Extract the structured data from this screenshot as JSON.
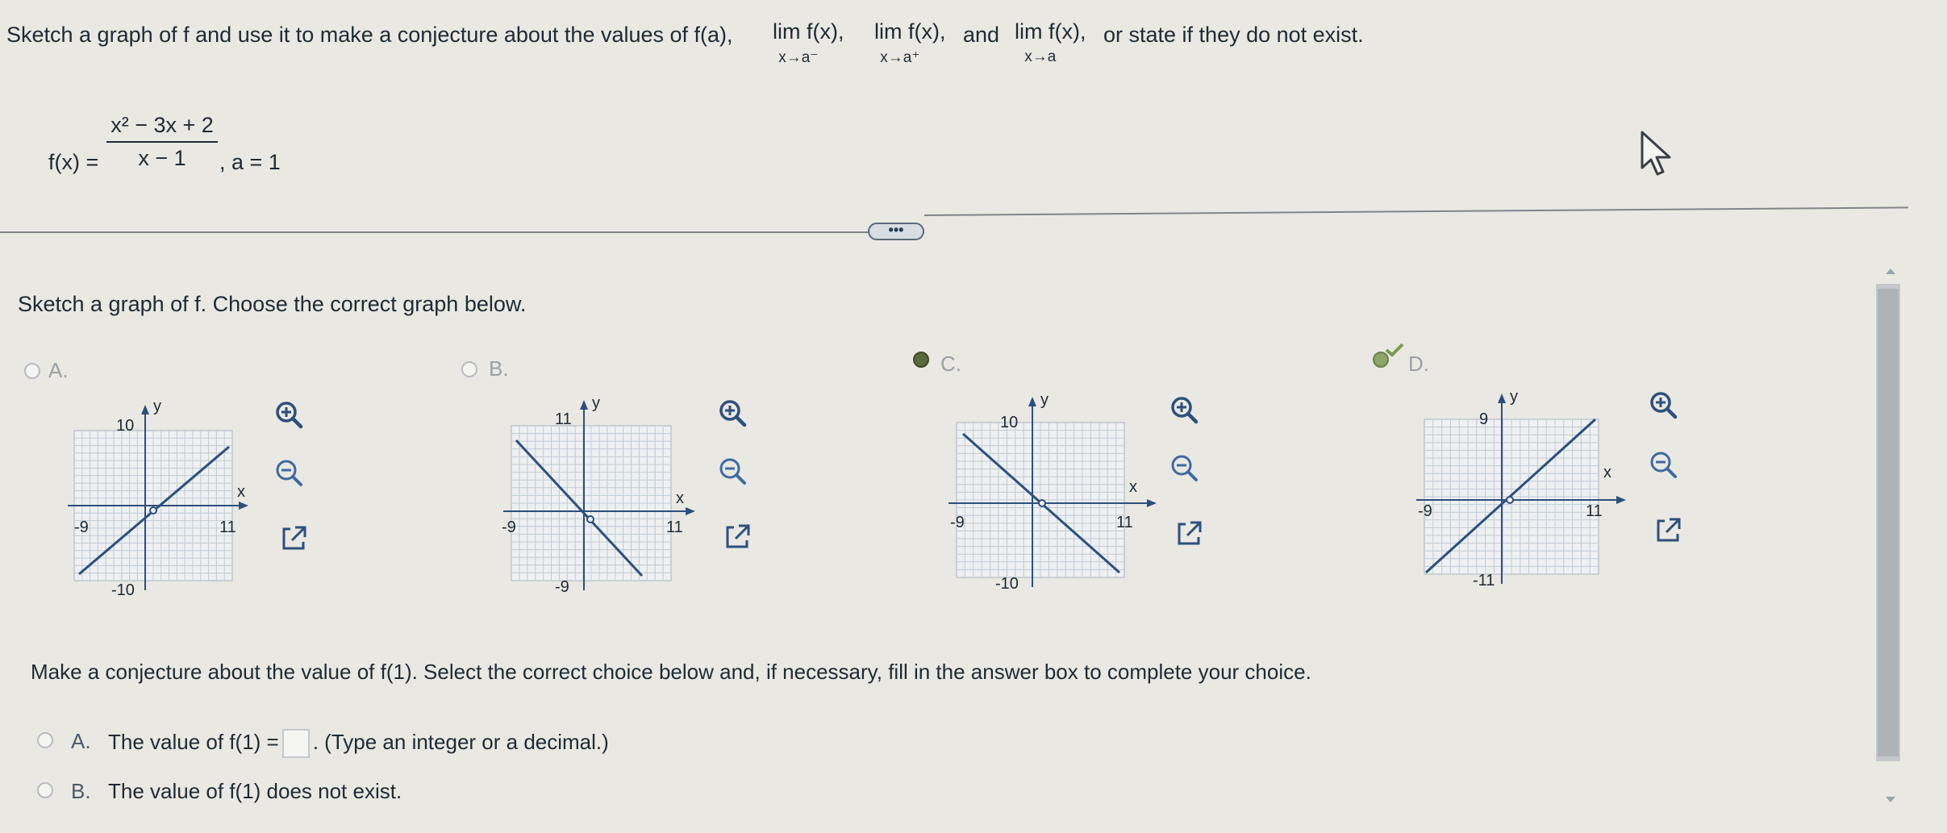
{
  "question": {
    "intro": "Sketch a graph of f and use it to make a conjecture about the values of f(a),",
    "lim1": "lim f(x),",
    "lim1_sub": "x→a⁻",
    "lim2": "lim f(x),",
    "lim2_sub": "x→a⁺",
    "and": "and",
    "lim3": "lim f(x),",
    "lim3_sub": "x→a",
    "outro": "or state if they do not exist.",
    "function_label": "f(x) =",
    "numerator": "x² − 3x + 2",
    "denominator": "x − 1",
    "a_value": ", a = 1"
  },
  "more_button": "•••",
  "part1": {
    "prompt": "Sketch a graph of f. Choose the correct graph below.",
    "options": [
      {
        "letter": "A.",
        "state": "unselected",
        "y_top": "10",
        "y_bottom": "-10",
        "x_left": "-9",
        "x_right": "11",
        "x_label": "x",
        "y_label": "y"
      },
      {
        "letter": "B.",
        "state": "unselected",
        "y_top": "11",
        "y_bottom": "-9",
        "x_left": "-9",
        "x_right": "11",
        "x_label": "x",
        "y_label": "y"
      },
      {
        "letter": "C.",
        "state": "selected",
        "y_top": "10",
        "y_bottom": "-10",
        "x_left": "-9",
        "x_right": "11",
        "x_label": "x",
        "y_label": "y"
      },
      {
        "letter": "D.",
        "state": "correct",
        "y_top": "9",
        "y_bottom": "-11",
        "x_left": "-9",
        "x_right": "11",
        "x_label": "x",
        "y_label": "y"
      }
    ],
    "icons": [
      "zoom-in-icon",
      "zoom-out-icon",
      "external-link-icon"
    ]
  },
  "part2": {
    "prompt": "Make a conjecture about the value of f(1). Select the correct choice below and, if necessary, fill in the answer box to complete your choice.",
    "choiceA_letter": "A.",
    "choiceA_pre": "The value of f(1) =",
    "choiceA_post": ". (Type an integer or a decimal.)",
    "choiceB_letter": "B.",
    "choiceB_text": "The value of f(1) does not exist."
  },
  "colors": {
    "background": "#e9e8e3",
    "text": "#1f2a33",
    "accent_blue": "#2d4f7c",
    "grid": "#b7c2cc",
    "correct_green": "#8ea56a"
  }
}
